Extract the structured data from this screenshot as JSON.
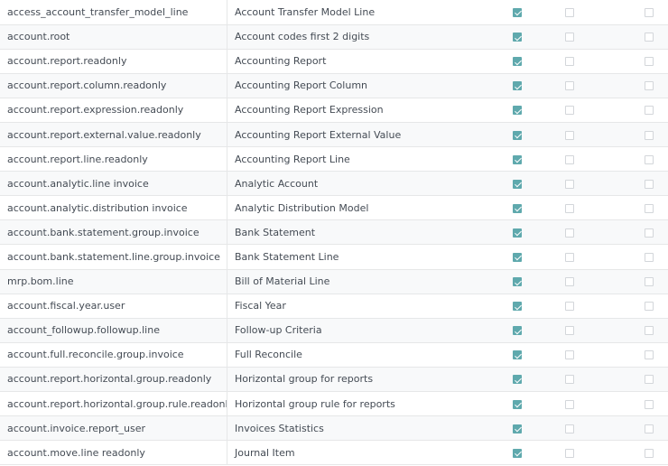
{
  "rows": [
    {
      "name": "access_account_transfer_model_line",
      "model": "Account Transfer Model Line",
      "read": true,
      "write": false,
      "create": false
    },
    {
      "name": "account.root",
      "model": "Account codes first 2 digits",
      "read": true,
      "write": false,
      "create": false
    },
    {
      "name": "account.report.readonly",
      "model": "Accounting Report",
      "read": true,
      "write": false,
      "create": false
    },
    {
      "name": "account.report.column.readonly",
      "model": "Accounting Report Column",
      "read": true,
      "write": false,
      "create": false
    },
    {
      "name": "account.report.expression.readonly",
      "model": "Accounting Report Expression",
      "read": true,
      "write": false,
      "create": false
    },
    {
      "name": "account.report.external.value.readonly",
      "model": "Accounting Report External Value",
      "read": true,
      "write": false,
      "create": false
    },
    {
      "name": "account.report.line.readonly",
      "model": "Accounting Report Line",
      "read": true,
      "write": false,
      "create": false
    },
    {
      "name": "account.analytic.line invoice",
      "model": "Analytic Account",
      "read": true,
      "write": false,
      "create": false
    },
    {
      "name": "account.analytic.distribution invoice",
      "model": "Analytic Distribution Model",
      "read": true,
      "write": false,
      "create": false
    },
    {
      "name": "account.bank.statement.group.invoice",
      "model": "Bank Statement",
      "read": true,
      "write": false,
      "create": false
    },
    {
      "name": "account.bank.statement.line.group.invoice",
      "model": "Bank Statement Line",
      "read": true,
      "write": false,
      "create": false
    },
    {
      "name": "mrp.bom.line",
      "model": "Bill of Material Line",
      "read": true,
      "write": false,
      "create": false
    },
    {
      "name": "account.fiscal.year.user",
      "model": "Fiscal Year",
      "read": true,
      "write": false,
      "create": false
    },
    {
      "name": "account_followup.followup.line",
      "model": "Follow-up Criteria",
      "read": true,
      "write": false,
      "create": false
    },
    {
      "name": "account.full.reconcile.group.invoice",
      "model": "Full Reconcile",
      "read": true,
      "write": false,
      "create": false
    },
    {
      "name": "account.report.horizontal.group.readonly",
      "model": "Horizontal group for reports",
      "read": true,
      "write": false,
      "create": false
    },
    {
      "name": "account.report.horizontal.group.rule.readonly",
      "model": "Horizontal group rule for reports",
      "read": true,
      "write": false,
      "create": false
    },
    {
      "name": "account.invoice.report_user",
      "model": "Invoices Statistics",
      "read": true,
      "write": false,
      "create": false
    },
    {
      "name": "account.move.line readonly",
      "model": "Journal Item",
      "read": true,
      "write": false,
      "create": false
    }
  ]
}
